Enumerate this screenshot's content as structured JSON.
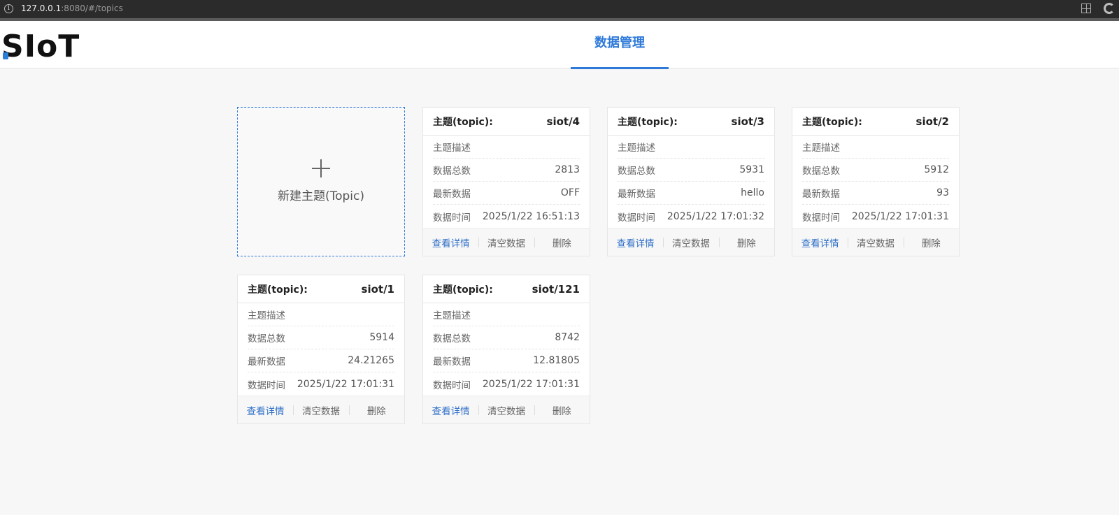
{
  "browser": {
    "url_host": "127.0.0.1",
    "url_rest": ":8080/#/topics"
  },
  "header": {
    "logo": "SIoT",
    "nav_tab": "数据管理"
  },
  "new_card": {
    "label": "新建主题(Topic)"
  },
  "labels": {
    "topic_prefix": "主题(topic):",
    "description": "主题描述",
    "total": "数据总数",
    "latest": "最新数据",
    "time": "数据时间",
    "view": "查看详情",
    "clear": "清空数据",
    "delete": "删除"
  },
  "topics": [
    {
      "name": "siot/4",
      "total": "2813",
      "latest": "OFF",
      "time": "2025/1/22 16:51:13"
    },
    {
      "name": "siot/3",
      "total": "5931",
      "latest": "hello",
      "time": "2025/1/22 17:01:32"
    },
    {
      "name": "siot/2",
      "total": "5912",
      "latest": "93",
      "time": "2025/1/22 17:01:31"
    },
    {
      "name": "siot/1",
      "total": "5914",
      "latest": "24.21265",
      "time": "2025/1/22 17:01:31"
    },
    {
      "name": "siot/121",
      "total": "8742",
      "latest": "12.81805",
      "time": "2025/1/22 17:01:31"
    }
  ]
}
